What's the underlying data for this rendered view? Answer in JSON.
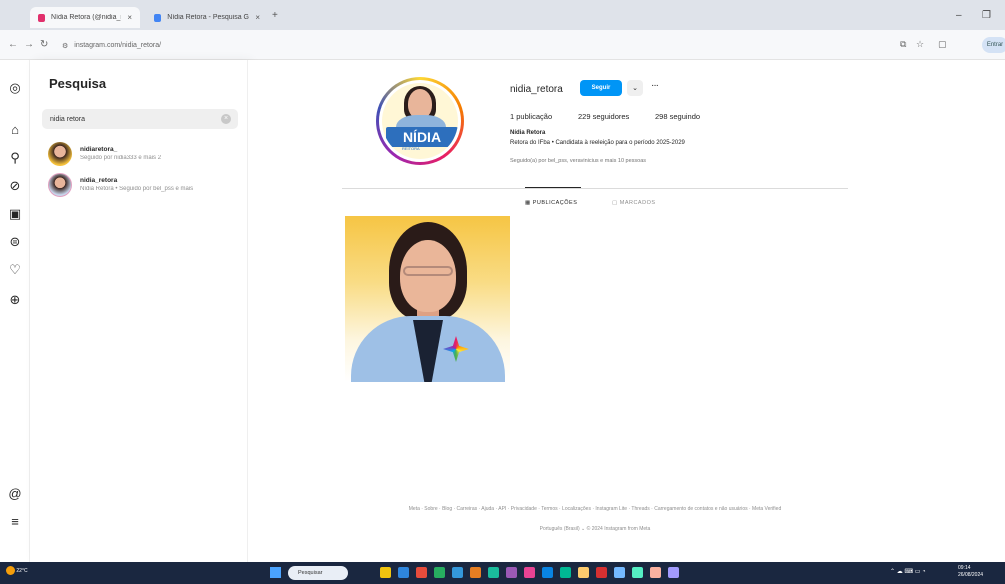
{
  "browser": {
    "tabs": [
      {
        "title": "Nídia Retora (@nidia_retora) • Instagram",
        "active": true,
        "favicon_color": "#e1306c"
      },
      {
        "title": "Nídia Retora - Pesquisa Google",
        "active": false,
        "favicon_color": "#4285f4"
      }
    ],
    "new_tab_icon": "plus-icon",
    "address": "instagram.com/nidia_retora/",
    "profile_label": "Entrar"
  },
  "rail": {
    "icons": [
      "instagram-icon",
      "home-icon",
      "search-icon",
      "explore-icon",
      "reels-icon",
      "messages-icon",
      "notifications-icon",
      "create-icon",
      "threads-icon",
      "menu-icon"
    ]
  },
  "search": {
    "title": "Pesquisa",
    "query": "nidia retora",
    "clear_icon": "×",
    "results": [
      {
        "username": "nidiaretora_",
        "subtitle": "Seguido por nidia333 e mais 2"
      },
      {
        "username": "nidia_retora",
        "subtitle": "Nídia Retora • Seguido por bel_pss e mais"
      }
    ]
  },
  "profile": {
    "username": "nidia_retora",
    "follow_label": "Seguir",
    "chevron_label": "⌄",
    "more_label": "···",
    "stats": [
      {
        "text": "1 publicação"
      },
      {
        "text": "229 seguidores"
      },
      {
        "text": "298 seguindo"
      }
    ],
    "full_name": "Nídia Retora",
    "bio": "Retora do IFba • Candidata à reeleição para o período 2025-2029",
    "followed_by": "Seguido(a) por bel_pss, veravinicius e mais 10 pessoas",
    "avatar_text": "NÍDIA",
    "avatar_subtext": "REITORA",
    "tabs": [
      {
        "label": "PUBLICAÇÕES",
        "active": true
      },
      {
        "label": "MARCADOS",
        "active": false
      }
    ]
  },
  "footer": {
    "links": "Meta · Sobre · Blog · Carreiras · Ajuda · API · Privacidade · Termos · Localizações · Instagram Lite · Threads · Carregamento de contatos e não usuários · Meta Verified",
    "copyright": "Português (Brasil) ⌄   © 2024 Instagram from Meta"
  },
  "taskbar": {
    "weather": "22°C",
    "search_placeholder": "Pesquisar",
    "time": "09:14",
    "date": "26/08/2024"
  }
}
